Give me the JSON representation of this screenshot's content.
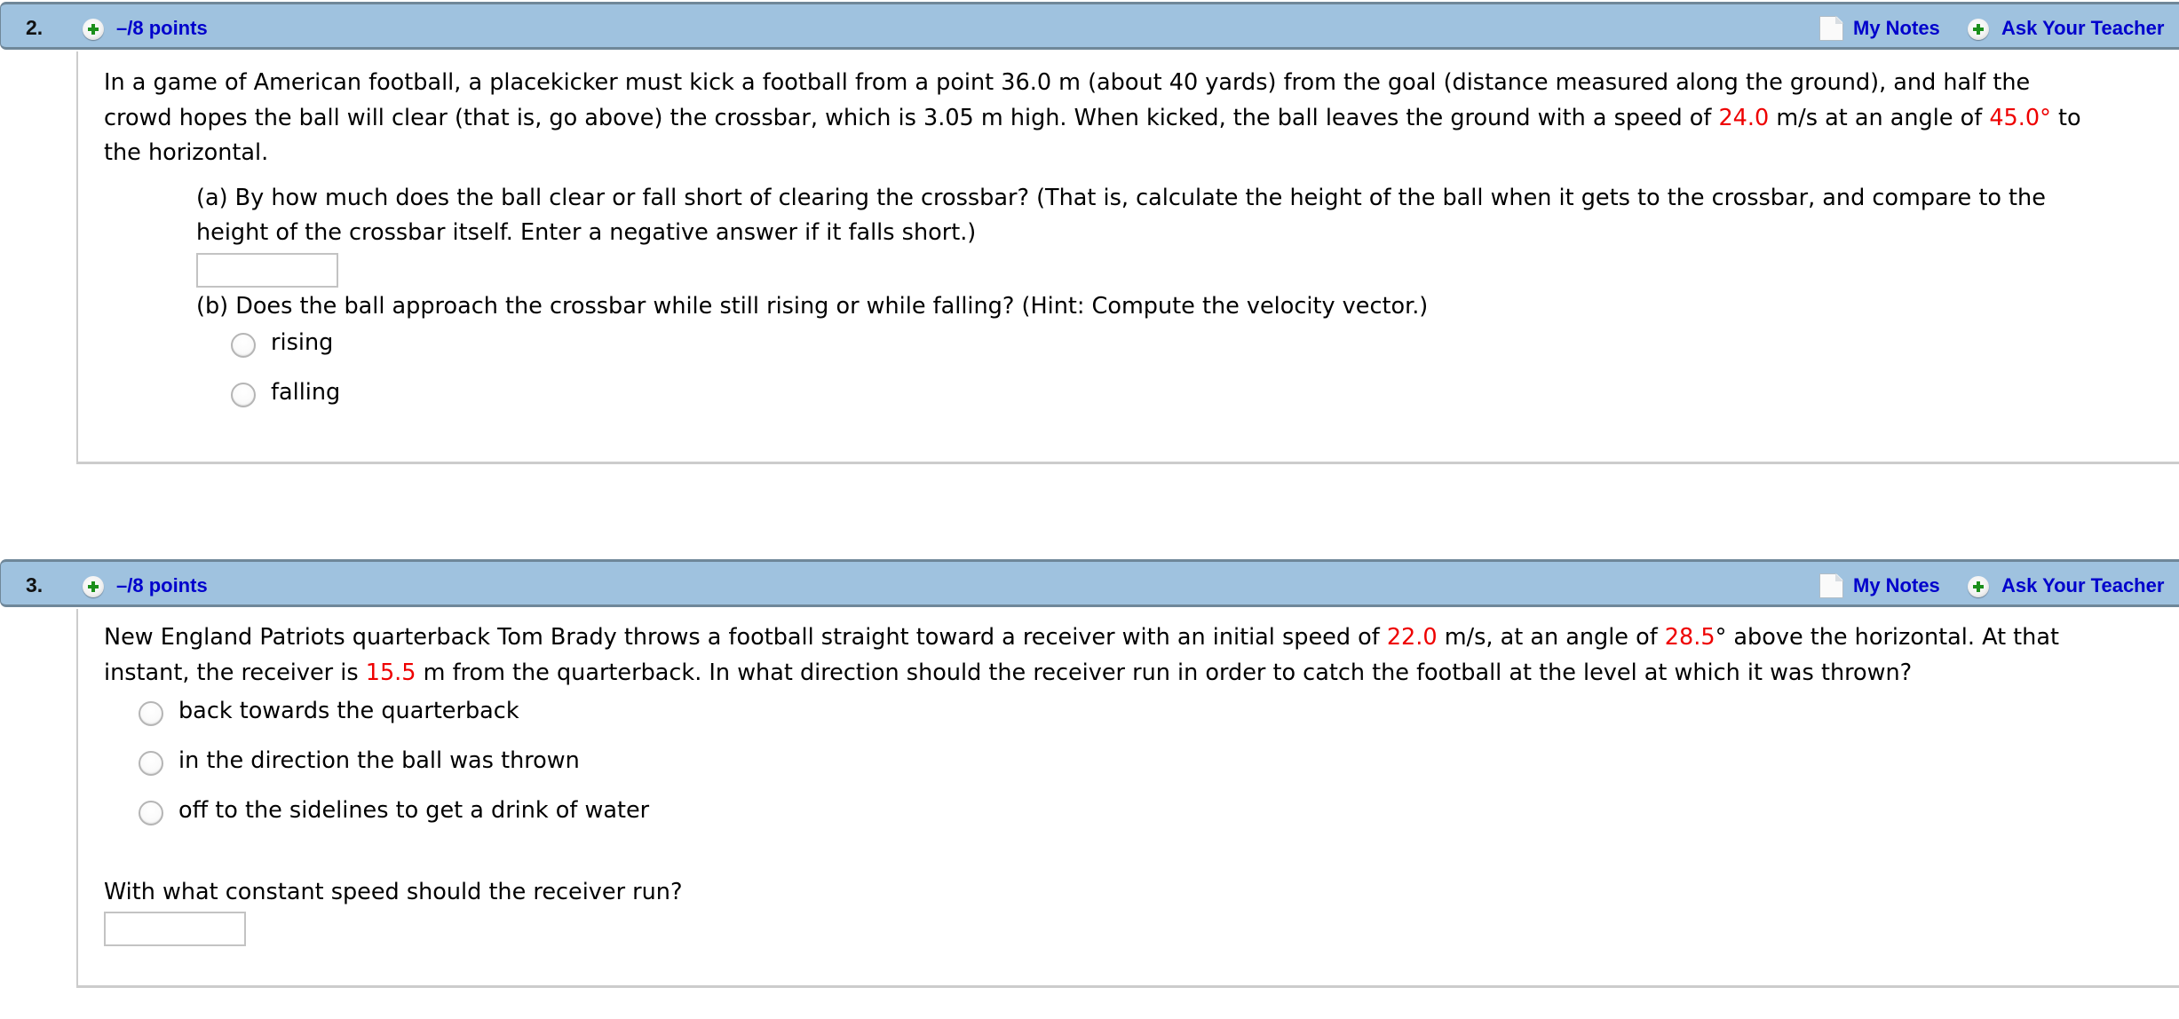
{
  "questions": [
    {
      "number": "2.",
      "points": "–/8 points",
      "my_notes": "My Notes",
      "ask_teacher": "Ask Your Teacher",
      "stem_lines": [
        [
          "In a game of American football, a placekicker must kick a football from a point 36.0 m (about 40 yards) from the goal (distance measured along the ground), and half the"
        ],
        [
          "crowd hopes the ball will clear (that is, go above) the crossbar, which is 3.05 m high. When kicked, the ball leaves the ground with a speed of ",
          "24.0",
          " m/s at an angle of ",
          "45.0°",
          " to"
        ],
        [
          "the horizontal."
        ]
      ],
      "part_a": {
        "lines": [
          "(a) By how much does the ball clear or fall short of clearing the crossbar? (That is, calculate the height of the ball when it gets to the crossbar, and compare to the",
          "height of the crossbar itself. Enter a negative answer if it falls short.)"
        ],
        "answer_value": ""
      },
      "part_b": {
        "prompt": "(b) Does the ball approach the crossbar while still rising or while falling? (Hint: Compute the velocity vector.)",
        "options": [
          "rising",
          "falling"
        ]
      }
    },
    {
      "number": "3.",
      "points": "–/8 points",
      "my_notes": "My Notes",
      "ask_teacher": "Ask Your Teacher",
      "stem_lines": [
        [
          "New England Patriots quarterback Tom Brady throws a football straight toward a receiver with an initial speed of ",
          "22.0",
          " m/s, at an angle of ",
          "28.5",
          "° above the horizontal. At that"
        ],
        [
          "instant, the receiver is ",
          "15.5",
          " m from the quarterback. In what direction should the receiver run in order to catch the football at the level at which it was thrown?"
        ]
      ],
      "options": [
        "back towards the quarterback",
        "in the direction the ball was thrown",
        "off to the sidelines to get a drink of water"
      ],
      "followup": {
        "prompt": "With what constant speed should the receiver run?",
        "answer_value": ""
      }
    }
  ],
  "colors": {
    "header_bg": "#9fc2df",
    "link": "#0000cc",
    "highlight": "#ee0000"
  }
}
